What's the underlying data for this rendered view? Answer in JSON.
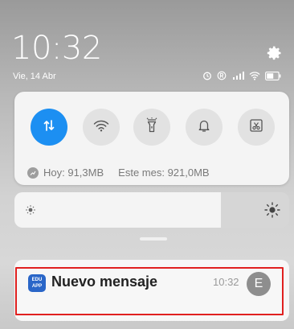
{
  "lockscreen": {
    "time": "10:32",
    "date": "Vie, 14 Abr",
    "status_icons": [
      "alarm-icon",
      "registered-icon",
      "cellular-signal-icon",
      "wifi-icon",
      "battery-icon"
    ]
  },
  "quick_settings": {
    "toggles": [
      {
        "name": "mobile-data",
        "icon": "mobile-data-icon",
        "active": true
      },
      {
        "name": "wifi",
        "icon": "wifi-icon",
        "active": false
      },
      {
        "name": "flashlight",
        "icon": "flashlight-icon",
        "active": false
      },
      {
        "name": "notifications",
        "icon": "bell-icon",
        "active": false
      },
      {
        "name": "screenshot",
        "icon": "screenshot-icon",
        "active": false
      }
    ],
    "usage_today": "Hoy: 91,3MB",
    "usage_month": "Este mes: 921,0MB",
    "accent_color": "#1c8ff2"
  },
  "brightness": {
    "level": 0.75
  },
  "notification": {
    "app_icon_text_top": "EDU",
    "app_icon_text_bottom": "APP",
    "title": "Nuevo mensaje",
    "time": "10:32",
    "avatar_letter": "E",
    "highlight_color": "#e0201f"
  }
}
